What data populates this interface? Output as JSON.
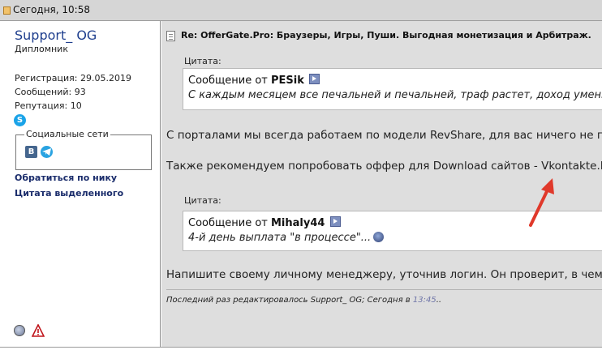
{
  "header": {
    "date_label": "Сегодня, 10:58"
  },
  "user": {
    "nick": "Support_ OG",
    "rank": "Дипломник",
    "registration": "Регистрация: 29.05.2019",
    "messages": "Сообщений: 93",
    "reputation": "Репутация: 10",
    "social_title": "Социальные сети",
    "vk_letter": "В",
    "link_by_nick": "Обратиться по нику",
    "link_quote_selected": "Цитата выделенного"
  },
  "post": {
    "title": "Re: OfferGate.Pro: Браузеры, Игры, Пуши. Выгодная монетизация и Арбитраж.",
    "quote1": {
      "label": "Цитата:",
      "from_prefix": "Сообщение от",
      "author": "PESik",
      "text": "С каждым месяцем все печальней и печальней, траф растет, доход уменьшается"
    },
    "paragraph1": "С порталами мы всегда работаем по модели RevShare, для вас ничего не поменялось.",
    "paragraph2": "Также рекомендуем попробовать оффер для Download сайтов - Vkontakte.Dj. Ен",
    "quote2": {
      "label": "Цитата:",
      "from_prefix": "Сообщение от",
      "author": "Mihaly44",
      "text": "4-й день выплата \"в процессе\"..."
    },
    "paragraph3": "Напишите своему личному менеджеру, уточнив логин. Он проверит, в чем пр",
    "edited_prefix": "Последний раз редактировалось Support_ OG; Сегодня в ",
    "edited_time": "13:45",
    "edited_suffix": ".."
  },
  "colors": {
    "topbar_bg": "#d6d6d6",
    "post_bg": "#dedede",
    "nick_color": "#1f3f8e",
    "link_color": "#1a2c6b",
    "annotation_arrow": "#e0392b"
  },
  "icons": [
    "post-icon",
    "skype-icon",
    "vk-icon",
    "telegram-icon",
    "doc-icon",
    "quote-arrow-icon",
    "smile-icon",
    "online-status-icon",
    "report-warning-icon",
    "red-annotation-arrow"
  ]
}
